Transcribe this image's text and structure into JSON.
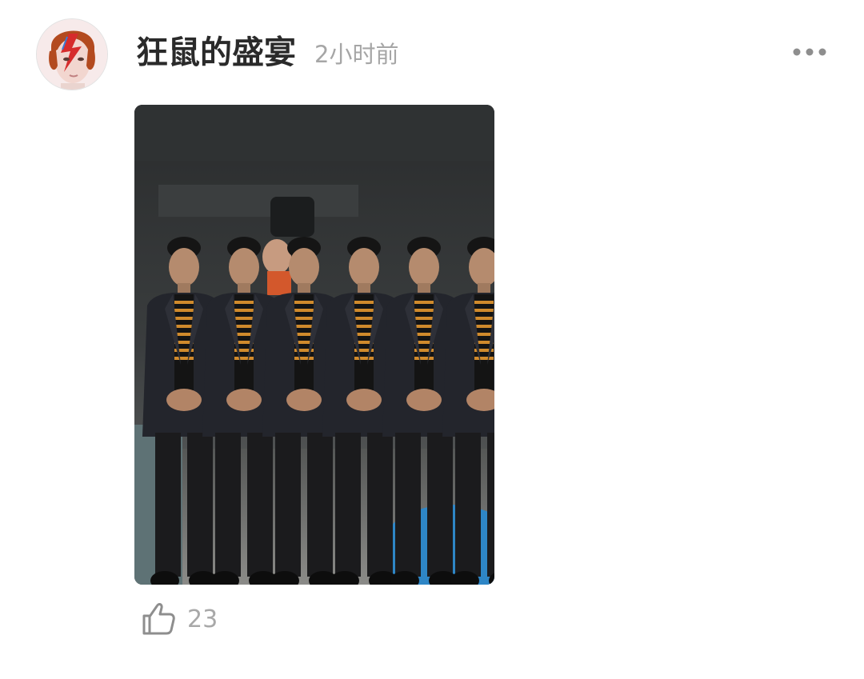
{
  "post": {
    "author": {
      "name": "狂鼠的盛宴",
      "avatar_icon": "lightning-bolt-face-avatar"
    },
    "time_ago": "2小时前",
    "more_icon": "more-dots-icon",
    "image_description_icon": "multiplied-person-photo",
    "likes": {
      "icon": "thumbs-up-icon",
      "count": "23"
    }
  },
  "colors": {
    "username": "#2a2a2a",
    "meta_gray": "#a6a6a6",
    "icon_gray": "#9b9b9b"
  }
}
